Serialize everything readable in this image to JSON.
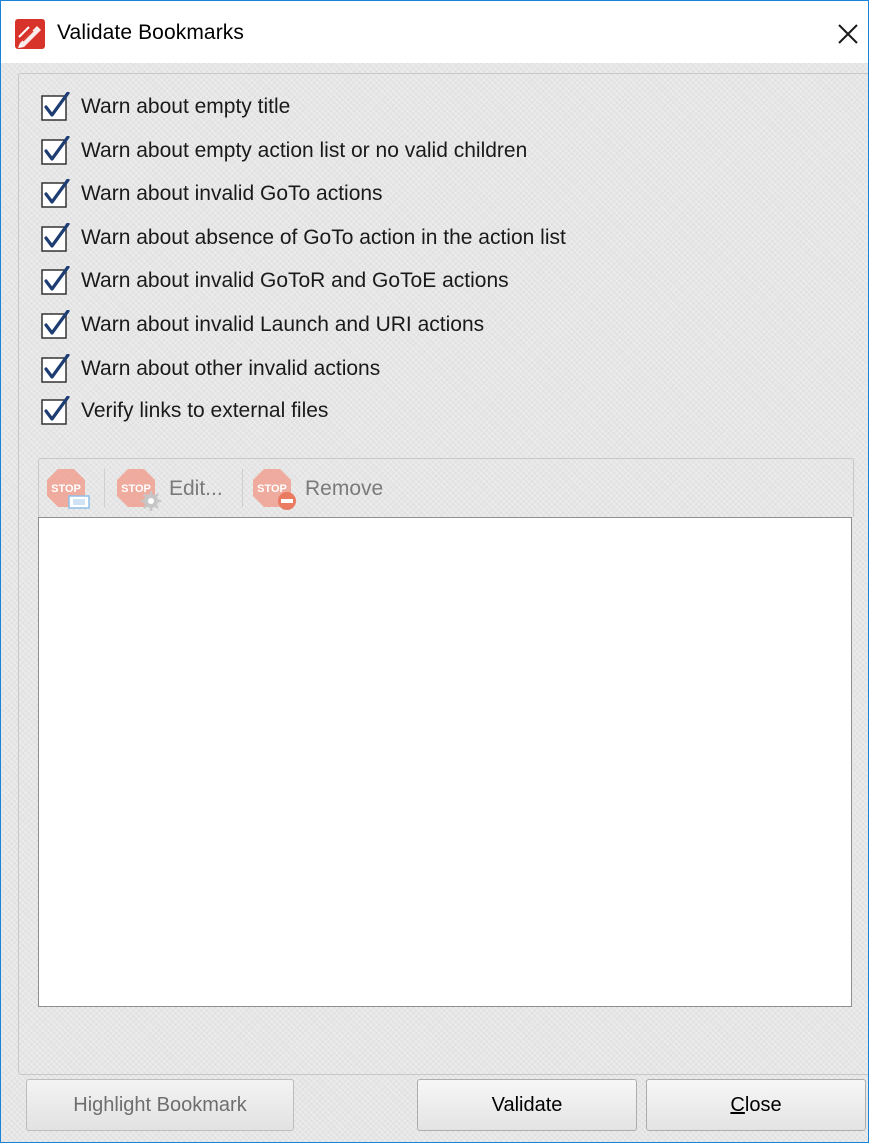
{
  "window": {
    "title": "Validate Bookmarks",
    "accent_color": "#1883d7"
  },
  "options": [
    {
      "label": "Warn about empty title",
      "checked": true
    },
    {
      "label": "Warn about empty action list or no valid children",
      "checked": true
    },
    {
      "label": "Warn about invalid GoTo actions",
      "checked": true
    },
    {
      "label": "Warn about absence of GoTo action in the action list",
      "checked": true
    },
    {
      "label": "Warn about invalid GoToR and GoToE actions",
      "checked": true
    },
    {
      "label": "Warn about invalid Launch and URI actions",
      "checked": true
    },
    {
      "label": "Warn about other invalid actions",
      "checked": true
    },
    {
      "label": "Verify links to external files",
      "checked": true
    }
  ],
  "toolbar": {
    "add_icon": "stop-sign-add-icon",
    "edit_label": "Edit...",
    "edit_icon": "stop-sign-gear-icon",
    "remove_label": "Remove",
    "remove_icon": "stop-sign-minus-icon",
    "icon_color": "#e8735a"
  },
  "buttons": {
    "highlight_label": "Highlight Bookmark",
    "validate_label": "Validate",
    "close_label": "Close"
  }
}
